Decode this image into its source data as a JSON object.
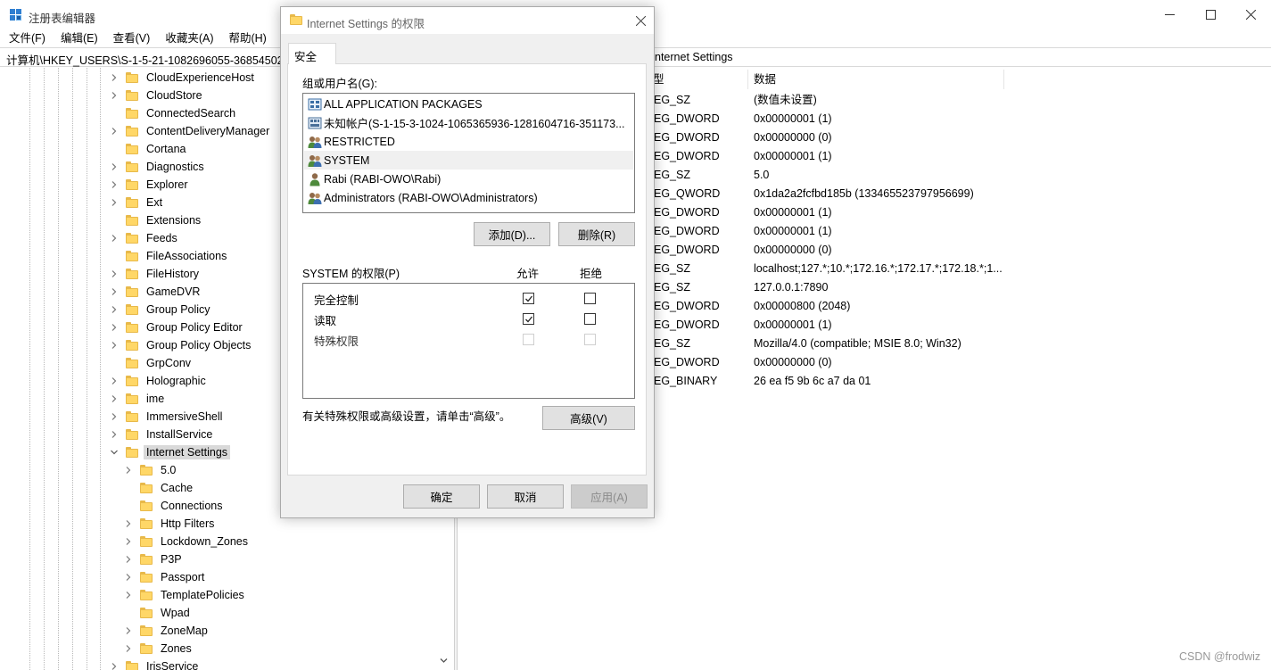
{
  "app": {
    "title": "注册表编辑器",
    "menu": [
      "文件(F)",
      "编辑(E)",
      "查看(V)",
      "收藏夹(A)",
      "帮助(H)"
    ]
  },
  "address": {
    "path_visible": "计算机\\HKEY_USERS\\S-1-5-21-1082696055-36854502",
    "path_tail": "nternet Settings"
  },
  "tree": {
    "items": [
      {
        "label": "CloudExperienceHost",
        "level": 0,
        "expandable": true
      },
      {
        "label": "CloudStore",
        "level": 0,
        "expandable": true
      },
      {
        "label": "ConnectedSearch",
        "level": 0,
        "expandable": false
      },
      {
        "label": "ContentDeliveryManager",
        "level": 0,
        "expandable": true
      },
      {
        "label": "Cortana",
        "level": 0,
        "expandable": false
      },
      {
        "label": "Diagnostics",
        "level": 0,
        "expandable": true
      },
      {
        "label": "Explorer",
        "level": 0,
        "expandable": true
      },
      {
        "label": "Ext",
        "level": 0,
        "expandable": true
      },
      {
        "label": "Extensions",
        "level": 0,
        "expandable": false
      },
      {
        "label": "Feeds",
        "level": 0,
        "expandable": true
      },
      {
        "label": "FileAssociations",
        "level": 0,
        "expandable": false
      },
      {
        "label": "FileHistory",
        "level": 0,
        "expandable": true
      },
      {
        "label": "GameDVR",
        "level": 0,
        "expandable": true
      },
      {
        "label": "Group Policy",
        "level": 0,
        "expandable": true
      },
      {
        "label": "Group Policy Editor",
        "level": 0,
        "expandable": true
      },
      {
        "label": "Group Policy Objects",
        "level": 0,
        "expandable": true
      },
      {
        "label": "GrpConv",
        "level": 0,
        "expandable": false
      },
      {
        "label": "Holographic",
        "level": 0,
        "expandable": true
      },
      {
        "label": "ime",
        "level": 0,
        "expandable": true
      },
      {
        "label": "ImmersiveShell",
        "level": 0,
        "expandable": true
      },
      {
        "label": "InstallService",
        "level": 0,
        "expandable": true
      },
      {
        "label": "Internet Settings",
        "level": 0,
        "expandable": true,
        "expanded": true,
        "selected": true
      },
      {
        "label": "5.0",
        "level": 1,
        "expandable": true
      },
      {
        "label": "Cache",
        "level": 1,
        "expandable": false
      },
      {
        "label": "Connections",
        "level": 1,
        "expandable": false
      },
      {
        "label": "Http Filters",
        "level": 1,
        "expandable": true
      },
      {
        "label": "Lockdown_Zones",
        "level": 1,
        "expandable": true
      },
      {
        "label": "P3P",
        "level": 1,
        "expandable": true
      },
      {
        "label": "Passport",
        "level": 1,
        "expandable": true
      },
      {
        "label": "TemplatePolicies",
        "level": 1,
        "expandable": true
      },
      {
        "label": "Wpad",
        "level": 1,
        "expandable": false
      },
      {
        "label": "ZoneMap",
        "level": 1,
        "expandable": true
      },
      {
        "label": "Zones",
        "level": 1,
        "expandable": true
      },
      {
        "label": "IrisService",
        "level": 0,
        "expandable": true
      }
    ]
  },
  "values": {
    "columns": {
      "type": "型",
      "data": "数据"
    },
    "rows": [
      {
        "type": "EG_SZ",
        "data": "(数值未设置)"
      },
      {
        "type": "EG_DWORD",
        "data": "0x00000001 (1)"
      },
      {
        "type": "EG_DWORD",
        "data": "0x00000000 (0)"
      },
      {
        "type": "EG_DWORD",
        "data": "0x00000001 (1)"
      },
      {
        "type": "EG_SZ",
        "data": "5.0"
      },
      {
        "type": "EG_QWORD",
        "data": "0x1da2a2fcfbd185b (133465523797956699)"
      },
      {
        "type": "EG_DWORD",
        "data": "0x00000001 (1)"
      },
      {
        "type": "EG_DWORD",
        "data": "0x00000001 (1)"
      },
      {
        "type": "EG_DWORD",
        "data": "0x00000000 (0)"
      },
      {
        "type": "EG_SZ",
        "data": "localhost;127.*;10.*;172.16.*;172.17.*;172.18.*;1..."
      },
      {
        "type": "EG_SZ",
        "data": "127.0.0.1:7890"
      },
      {
        "type": "EG_DWORD",
        "data": "0x00000800 (2048)"
      },
      {
        "type": "EG_DWORD",
        "data": "0x00000001 (1)"
      },
      {
        "type": "EG_SZ",
        "data": "Mozilla/4.0 (compatible; MSIE 8.0; Win32)"
      },
      {
        "type": "EG_DWORD",
        "data": "0x00000000 (0)"
      },
      {
        "type": "EG_BINARY",
        "data": "26 ea f5 9b 6c a7 da 01"
      }
    ]
  },
  "dialog": {
    "title": "Internet Settings 的权限",
    "tab": "安全",
    "group_label": "组或用户名(G):",
    "users": [
      {
        "label": "ALL APPLICATION PACKAGES",
        "icon": "app-packages-icon",
        "selected": false
      },
      {
        "label": "未知帐户(S-1-15-3-1024-1065365936-1281604716-351173...",
        "icon": "unknown-account-icon",
        "selected": false
      },
      {
        "label": "RESTRICTED",
        "icon": "group-icon",
        "selected": false
      },
      {
        "label": "SYSTEM",
        "icon": "group-icon",
        "selected": true
      },
      {
        "label": "Rabi (RABI-OWO\\Rabi)",
        "icon": "user-icon",
        "selected": false
      },
      {
        "label": "Administrators (RABI-OWO\\Administrators)",
        "icon": "group-icon",
        "selected": false
      }
    ],
    "add_button": "添加(D)...",
    "remove_button": "删除(R)",
    "perm_label": "SYSTEM 的权限(P)",
    "allow_header": "允许",
    "deny_header": "拒绝",
    "permissions": [
      {
        "label": "完全控制",
        "allow": true,
        "deny": false,
        "enabled": true
      },
      {
        "label": "读取",
        "allow": true,
        "deny": false,
        "enabled": true
      },
      {
        "label": "特殊权限",
        "allow": false,
        "deny": false,
        "enabled": false
      }
    ],
    "advanced_note": "有关特殊权限或高级设置，请单击“高级”。",
    "advanced_button": "高级(V)",
    "ok_button": "确定",
    "cancel_button": "取消",
    "apply_button": "应用(A)"
  },
  "watermark": "CSDN @frodwiz",
  "colors": {
    "folder": "#ffd767",
    "selection": "#d9d9d9",
    "accent": "#0078d7"
  }
}
